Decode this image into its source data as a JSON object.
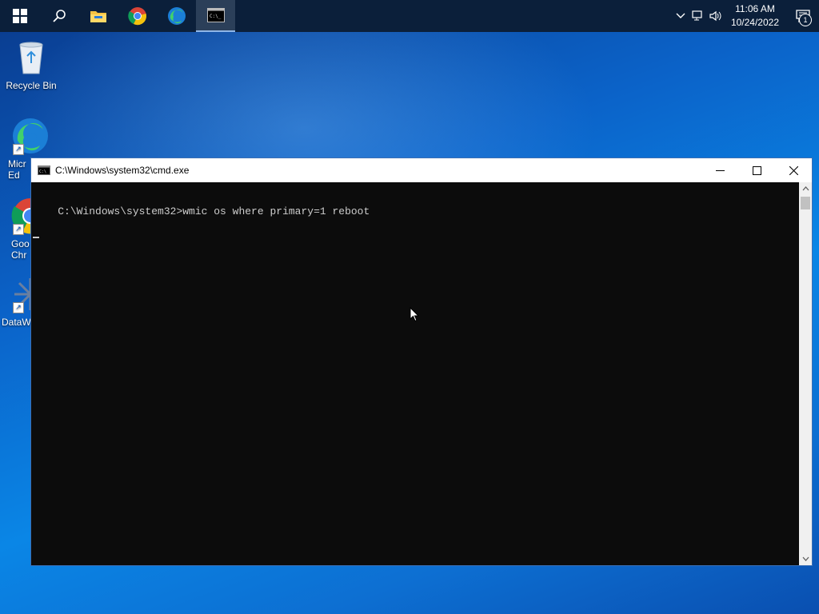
{
  "taskbar": {
    "apps": [
      {
        "name": "start",
        "icon": "windows-logo-icon"
      },
      {
        "name": "search",
        "icon": "search-icon"
      },
      {
        "name": "file-explorer",
        "icon": "folder-icon"
      },
      {
        "name": "chrome",
        "icon": "chrome-icon"
      },
      {
        "name": "edge",
        "icon": "edge-icon"
      },
      {
        "name": "cmd",
        "icon": "cmd-icon",
        "active": true
      }
    ],
    "clock": {
      "time": "11:06 AM",
      "date": "10/24/2022"
    },
    "notification_count": "1"
  },
  "desktop": {
    "icons": [
      {
        "label": "Recycle Bin",
        "icon": "recycle-bin-icon"
      },
      {
        "label": "Micr\nEd",
        "icon": "edge-icon"
      },
      {
        "label": "Goo\nChr",
        "icon": "chrome-icon"
      },
      {
        "label": "DataW",
        "icon": "datawrapper-icon"
      }
    ]
  },
  "cmd_window": {
    "title": "C:\\Windows\\system32\\cmd.exe",
    "console_line": "C:\\Windows\\system32>wmic os where primary=1 reboot"
  },
  "colors": {
    "taskbar": "#0b1f3a",
    "console_bg": "#0c0c0c",
    "console_text": "#cccccc"
  }
}
